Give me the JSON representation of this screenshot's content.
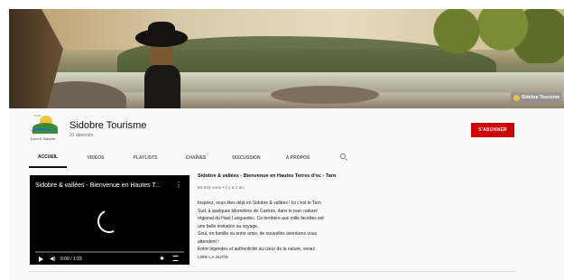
{
  "banner": {
    "watermark_text": "Sidobre Tourisme"
  },
  "channel": {
    "logo_top_text": "JOUR",
    "logo_bottom_text": "Lacs & Sidobre",
    "name": "Sidobre Tourisme",
    "subscribers": "21 abonnés",
    "subscribe_label": "S'ABONNER",
    "accent_color": "#cc0000"
  },
  "tabs": [
    {
      "label": "ACCUEIL",
      "active": true
    },
    {
      "label": "VIDÉOS"
    },
    {
      "label": "PLAYLISTS"
    },
    {
      "label": "CHAÎNES"
    },
    {
      "label": "DISCUSSION"
    },
    {
      "label": "À PROPOS"
    }
  ],
  "tab_search_icon": "search-icon",
  "player": {
    "title": "Sidobre & vallées - Bienvenue en Hautes T...",
    "menu_glyph": "⋮",
    "time": "0:00 / 1:33",
    "icons": [
      "play-icon",
      "volume-icon",
      "settings-icon",
      "fullscreen-icon"
    ]
  },
  "video": {
    "title": "Sidobre & vallées - Bienvenue en Hautes Terres d'oc - Tarn",
    "meta": "84 915 vues • il y a 1 an",
    "description": [
      "Inspirez, vous êtes déjà en Sidobre & vallées ! Ici c'est le Tarn",
      "Sud, à quelques kilomètres de Castres, dans le parc naturel",
      "régional du Haut Languedoc. Ce territoire aux mille facettes est",
      "une belle invitation au voyage.",
      "Seul, en famille ou entre amis, de nouvelles aventures vous",
      "attendent !",
      "Entre légendes et authenticité au cœur de la nature, venez"
    ],
    "read_more": "LIRE LA SUITE"
  }
}
